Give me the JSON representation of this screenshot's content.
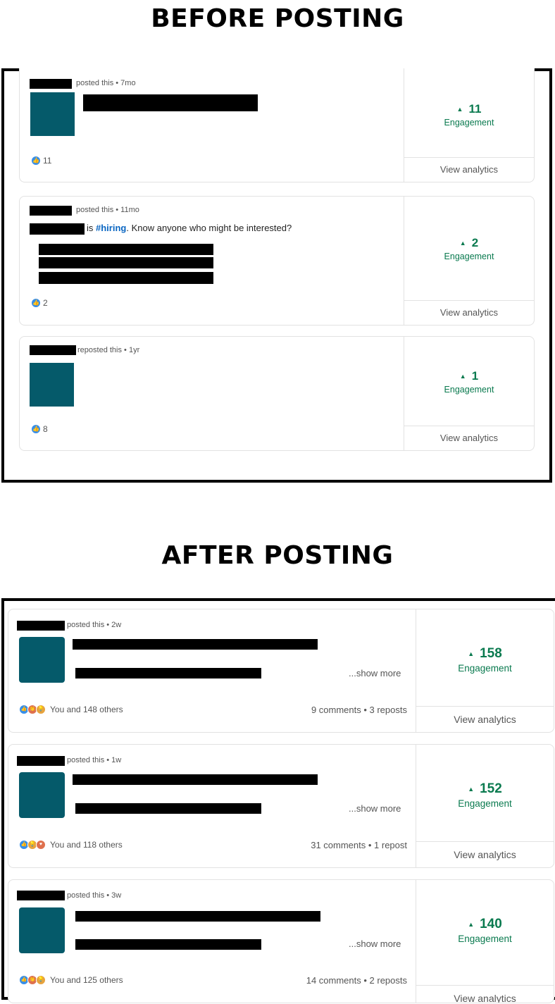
{
  "before": {
    "heading": "BEFORE POSTING",
    "posts": [
      {
        "meta": "posted this • 7mo",
        "reactions": "11",
        "engagement": "11",
        "engagement_label": "Engagement",
        "view": "View analytics"
      },
      {
        "meta": "posted this • 11mo",
        "text_prefix": "is",
        "hashtag": "#hiring",
        "text_rest": ". Know anyone who might be interested?",
        "reactions": "2",
        "engagement": "2",
        "engagement_label": "Engagement",
        "view": "View analytics"
      },
      {
        "meta": "reposted this • 1yr",
        "reactions": "8",
        "engagement": "1",
        "engagement_label": "Engagement",
        "view": "View analytics"
      }
    ]
  },
  "after": {
    "heading": "AFTER POSTING",
    "posts": [
      {
        "meta": "posted this • 2w",
        "show_more": "...show more",
        "reactions": "You and 148 others",
        "stats": "9 comments • 3 reposts",
        "engagement": "158",
        "engagement_label": "Engagement",
        "view": "View analytics"
      },
      {
        "meta": "posted this • 1w",
        "show_more": "...show more",
        "reactions": "You and 118 others",
        "stats": "31 comments • 1 repost",
        "engagement": "152",
        "engagement_label": "Engagement",
        "view": "View analytics"
      },
      {
        "meta": "posted this • 3w",
        "show_more": "...show more",
        "reactions": "You and 125 others",
        "stats": "14 comments • 2 reposts",
        "engagement": "140",
        "engagement_label": "Engagement",
        "view": "View analytics"
      }
    ]
  },
  "icons": {
    "triangle": "triangle-up-icon",
    "like": "like-reaction-icon",
    "celebrate": "celebrate-reaction-icon",
    "love": "love-reaction-icon",
    "insightful": "insightful-reaction-icon"
  },
  "colors": {
    "engagement": "#0a7a4f",
    "hashtag": "#0a66c2",
    "like": "#378fe9",
    "thumbnail": "#055a6a"
  }
}
